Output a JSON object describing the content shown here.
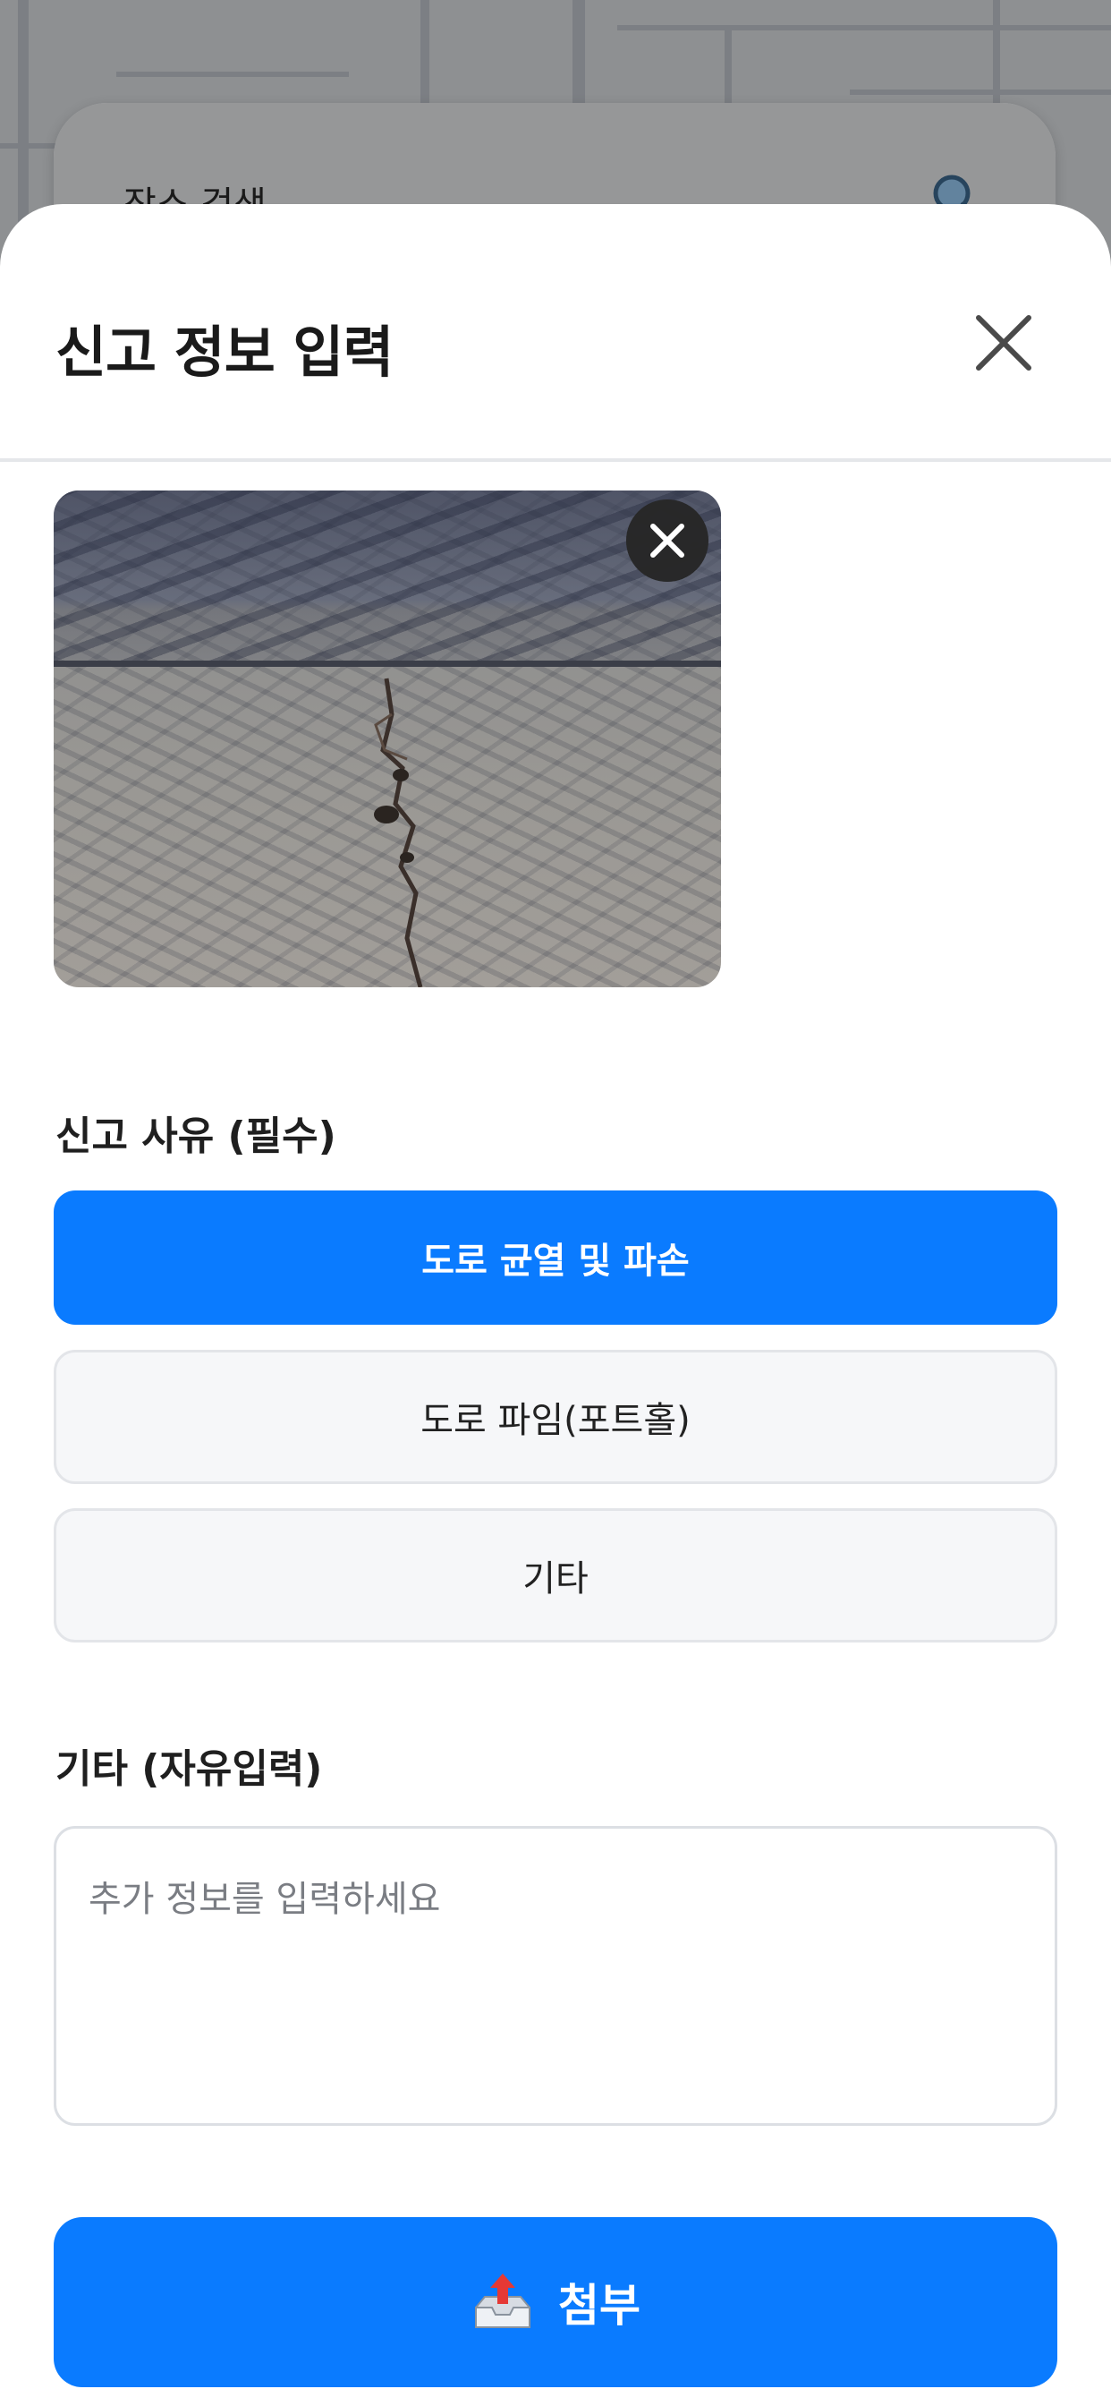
{
  "map": {
    "search_placeholder": "장소 검색"
  },
  "sheet": {
    "title": "신고 정보 입력",
    "close_icon": "close-icon"
  },
  "photo": {
    "remove_icon": "close-icon",
    "description_icon": "road-crack-photo"
  },
  "reason_section": {
    "label": "신고 사유 (필수)",
    "options": [
      {
        "label": "도로 균열 및 파손",
        "selected": true
      },
      {
        "label": "도로 파임(포트홀)",
        "selected": false
      },
      {
        "label": "기타",
        "selected": false
      }
    ]
  },
  "free_input_section": {
    "label": "기타 (자유입력)",
    "placeholder": "추가 정보를 입력하세요",
    "value": ""
  },
  "attach_button": {
    "label": "첨부",
    "icon": "outbox-tray-icon"
  },
  "colors": {
    "accent": "#0a7bff",
    "unselected_bg": "#f6f7f9",
    "text_primary": "#1a1a1a"
  }
}
